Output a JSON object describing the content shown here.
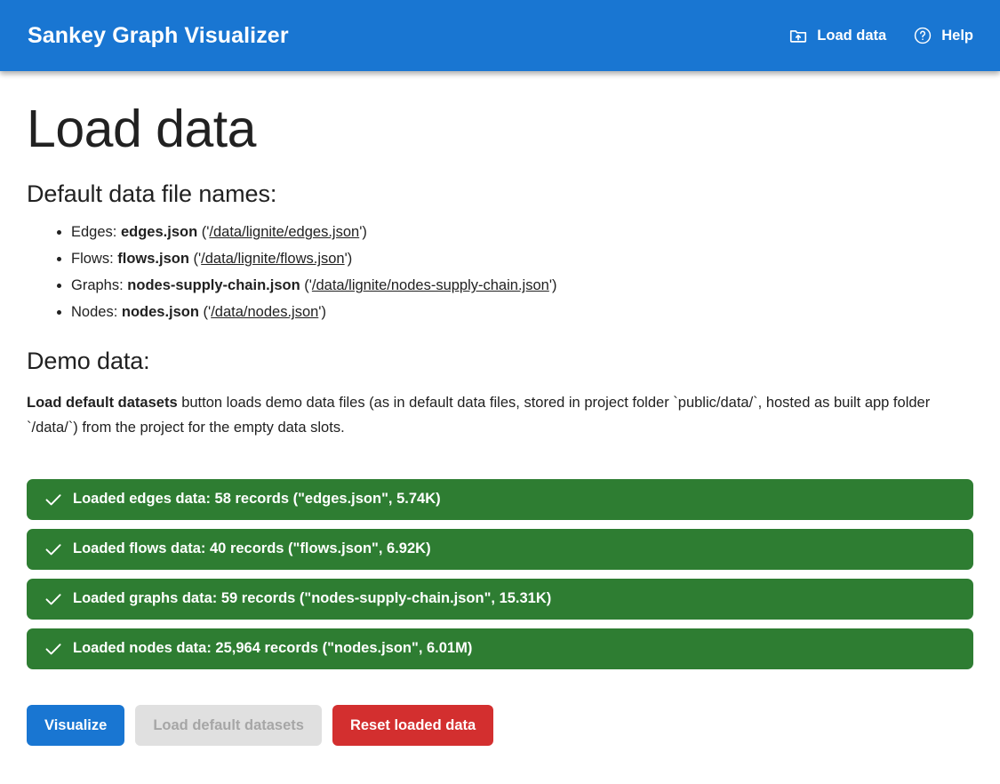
{
  "header": {
    "title": "Sankey Graph Visualizer",
    "actions": [
      {
        "label": "Load data",
        "icon": "upload-folder-icon"
      },
      {
        "label": "Help",
        "icon": "help-circle-icon"
      }
    ]
  },
  "main": {
    "page_title": "Load data",
    "default_files_heading": "Default data file names:",
    "files": [
      {
        "label": "Edges:",
        "name": "edges.json",
        "open_paren": " ('",
        "path": "/data/lignite/edges.json",
        "close_paren": "')"
      },
      {
        "label": "Flows:",
        "name": "flows.json",
        "open_paren": " ('",
        "path": "/data/lignite/flows.json",
        "close_paren": "')"
      },
      {
        "label": "Graphs:",
        "name": "nodes-supply-chain.json",
        "open_paren": " ('",
        "path": "/data/lignite/nodes-supply-chain.json",
        "close_paren": "')"
      },
      {
        "label": "Nodes:",
        "name": "nodes.json",
        "open_paren": " ('",
        "path": "/data/nodes.json",
        "close_paren": "')"
      }
    ],
    "demo_heading": "Demo data:",
    "demo_paragraph": {
      "bold_lead": "Load default datasets",
      "rest": " button loads demo data files (as in default data files, stored in project folder `public/data/`, hosted as built app folder `/data/`) from the project for the empty data slots."
    },
    "alerts": [
      {
        "icon": "check-icon",
        "text": "Loaded edges data: 58 records (\"edges.json\", 5.74K)",
        "color": "#2e7d32"
      },
      {
        "icon": "check-icon",
        "text": "Loaded flows data: 40 records (\"flows.json\", 6.92K)",
        "color": "#2e7d32"
      },
      {
        "icon": "check-icon",
        "text": "Loaded graphs data: 59 records (\"nodes-supply-chain.json\", 15.31K)",
        "color": "#2e7d32"
      },
      {
        "icon": "check-icon",
        "text": "Loaded nodes data: 25,964 records (\"nodes.json\", 6.01M)",
        "color": "#2e7d32"
      }
    ],
    "buttons": [
      {
        "label": "Visualize",
        "style": "primary",
        "color": "#1976d2",
        "disabled": false
      },
      {
        "label": "Load default datasets",
        "style": "disabled",
        "color": "#e0e0e0",
        "disabled": true
      },
      {
        "label": "Reset loaded data",
        "style": "danger",
        "color": "#d32f2f",
        "disabled": false
      }
    ]
  },
  "theme": {
    "appbar_color": "#1976d2",
    "success_color": "#2e7d32",
    "danger_color": "#d32f2f",
    "text_color": "#212121"
  }
}
